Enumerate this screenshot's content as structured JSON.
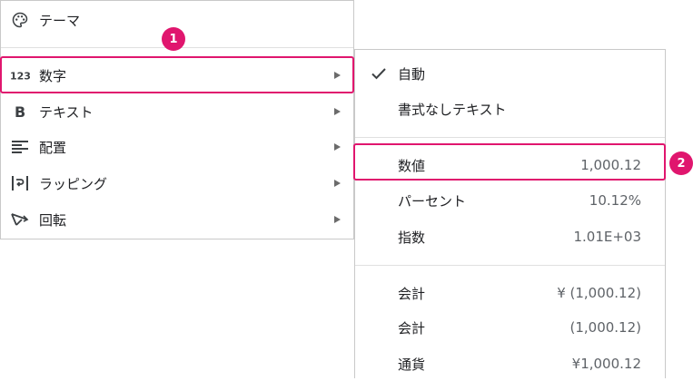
{
  "colors": {
    "highlight": "#e0166e",
    "text": "#202124",
    "muted": "#5f6368"
  },
  "main_menu": {
    "items": [
      {
        "label": "テーマ",
        "icon": "palette-icon",
        "has_submenu": false
      },
      {
        "label": "数字",
        "icon": "number-format-123-icon",
        "has_submenu": true
      },
      {
        "label": "テキスト",
        "icon": "bold-icon",
        "has_submenu": true
      },
      {
        "label": "配置",
        "icon": "align-left-icon",
        "has_submenu": true
      },
      {
        "label": "ラッピング",
        "icon": "text-wrap-icon",
        "has_submenu": true
      },
      {
        "label": "回転",
        "icon": "text-rotation-icon",
        "has_submenu": true
      }
    ]
  },
  "sub_menu": {
    "items": [
      {
        "label": "自動",
        "example": "",
        "checked": true
      },
      {
        "label": "書式なしテキスト",
        "example": "",
        "checked": false
      },
      {
        "label": "数値",
        "example": "1,000.12",
        "checked": false
      },
      {
        "label": "パーセント",
        "example": "10.12%",
        "checked": false
      },
      {
        "label": "指数",
        "example": "1.01E+03",
        "checked": false
      },
      {
        "label": "会計",
        "example": "¥ (1,000.12)",
        "checked": false
      },
      {
        "label": "会計",
        "example": "(1,000.12)",
        "checked": false
      },
      {
        "label": "通貨",
        "example": "¥1,000.12",
        "checked": false
      }
    ]
  },
  "annotations": {
    "badge1": "1",
    "badge2": "2"
  }
}
